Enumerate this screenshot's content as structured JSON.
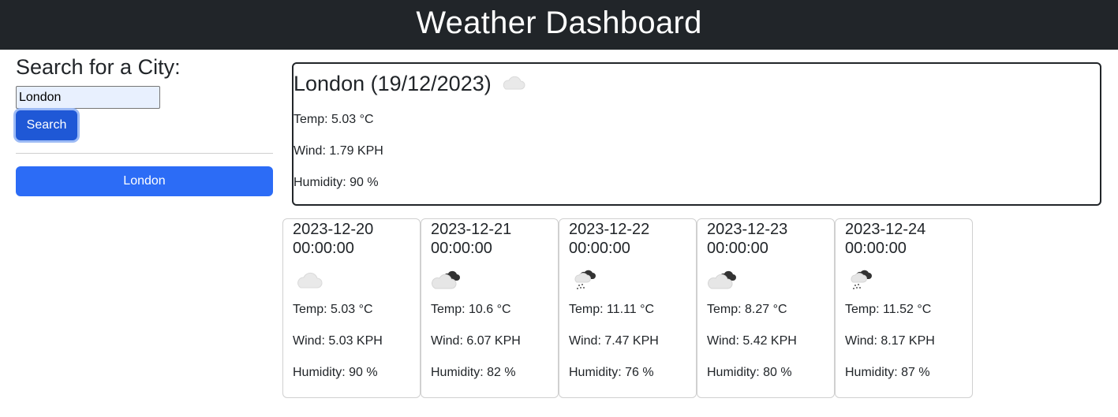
{
  "header": {
    "title": "Weather Dashboard"
  },
  "sidebar": {
    "heading": "Search for a City:",
    "search_value": "London",
    "search_button": "Search",
    "history": [
      "London"
    ]
  },
  "current": {
    "title": "London (19/12/2023)",
    "icon": "cloud-icon",
    "temp": "Temp: 5.03 °C",
    "wind": "Wind: 1.79 KPH",
    "humidity": "Humidity: 90 %"
  },
  "forecast": [
    {
      "date": "2023-12-20 00:00:00",
      "icon": "cloud-icon",
      "temp": "Temp: 5.03 °C",
      "wind": "Wind: 5.03 KPH",
      "humidity": "Humidity: 90 %"
    },
    {
      "date": "2023-12-21 00:00:00",
      "icon": "dark-clouds-icon",
      "temp": "Temp: 10.6 °C",
      "wind": "Wind: 6.07 KPH",
      "humidity": "Humidity: 82 %"
    },
    {
      "date": "2023-12-22 00:00:00",
      "icon": "snow-cloud-icon",
      "temp": "Temp: 11.11 °C",
      "wind": "Wind: 7.47 KPH",
      "humidity": "Humidity: 76 %"
    },
    {
      "date": "2023-12-23 00:00:00",
      "icon": "dark-clouds-icon",
      "temp": "Temp: 8.27 °C",
      "wind": "Wind: 5.42 KPH",
      "humidity": "Humidity: 80 %"
    },
    {
      "date": "2023-12-24 00:00:00",
      "icon": "snow-cloud-icon",
      "temp": "Temp: 11.52 °C",
      "wind": "Wind: 8.17 KPH",
      "humidity": "Humidity: 87 %"
    }
  ]
}
